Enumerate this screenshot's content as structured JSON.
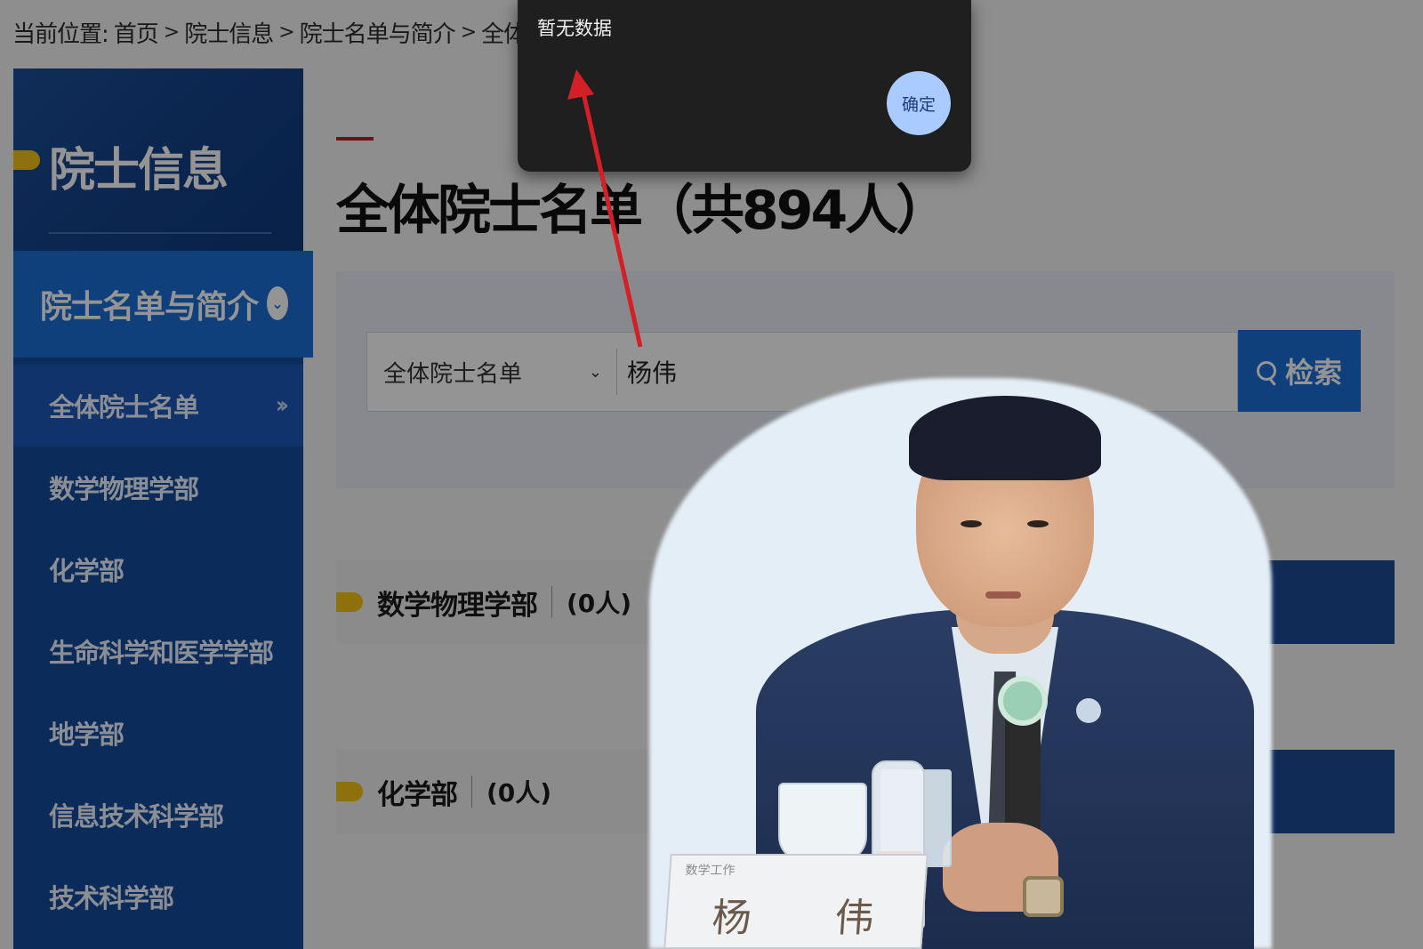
{
  "breadcrumb": {
    "prefix": "当前位置:",
    "items": [
      "首页",
      "院士信息",
      "院士名单与简介",
      "全体院士名单"
    ],
    "separator": ">"
  },
  "sidebar": {
    "title": "院士信息",
    "active_section": "院士名单与简介",
    "items": [
      {
        "label": "全体院士名单",
        "current": true
      },
      {
        "label": "数学物理学部"
      },
      {
        "label": "化学部"
      },
      {
        "label": "生命科学和医学学部"
      },
      {
        "label": "地学部"
      },
      {
        "label": "信息技术科学部"
      },
      {
        "label": "技术科学部"
      }
    ]
  },
  "main": {
    "heading": "全体院士名单（共894人）",
    "search": {
      "select_value": "全体院士名单",
      "query_value": "杨伟",
      "button_label": "检索"
    },
    "sections": [
      {
        "name": "数学物理学部",
        "count": "(0人)"
      },
      {
        "name": "化学部",
        "count": "(0人)"
      }
    ]
  },
  "modal": {
    "message": "暂无数据",
    "ok_label": "确定"
  },
  "photo": {
    "nameplate_name": "杨 伟",
    "nameplate_top": "数学工作"
  },
  "colors": {
    "sidebar_bg": "#134a9b",
    "accent_blue": "#1a6fd4",
    "marker_yellow": "#f2c317",
    "heading_red_bar": "#c61d23",
    "modal_bg": "#1f1f1f",
    "modal_ok_bg": "#a9cbff",
    "arrow_red": "#d41f26"
  }
}
